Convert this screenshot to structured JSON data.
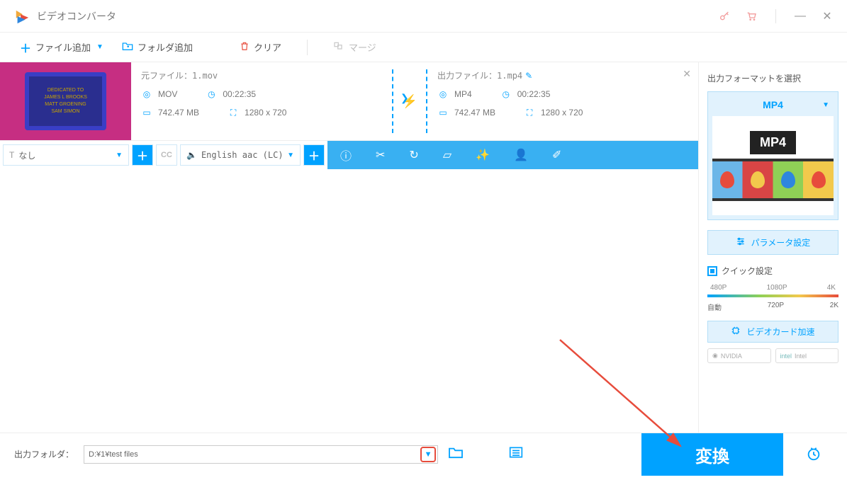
{
  "app_title": "ビデオコンバータ",
  "toolbar": {
    "add_file": "ファイル追加",
    "add_folder": "フォルダ追加",
    "clear": "クリア",
    "merge": "マージ"
  },
  "file": {
    "src_label": "元ファイル：",
    "src_name": "1.mov",
    "src_format": "MOV",
    "src_duration": "00:22:35",
    "src_size": "742.47 MB",
    "src_res": "1280 x 720",
    "out_label": "出力ファイル：",
    "out_name": "1.mp4",
    "out_format": "MP4",
    "out_duration": "00:22:35",
    "out_size": "742.47 MB",
    "out_res": "1280 x 720"
  },
  "sa": {
    "subtitle_value": "なし",
    "audio_value": "English aac (LC)"
  },
  "sidebar": {
    "title": "出力フォーマットを選択",
    "format": "MP4",
    "format_caption": "MP4",
    "param_btn": "パラメータ設定",
    "quick_title": "クイック設定",
    "scale_top": [
      "480P",
      "1080P",
      "4K"
    ],
    "scale_bottom": [
      "自動",
      "720P",
      "2K"
    ],
    "gpu_btn": "ビデオカード加速",
    "gpu_nvidia": "NVIDIA",
    "gpu_intel": "Intel"
  },
  "bottom": {
    "folder_label": "出力フォルダ：",
    "folder_path": "D:¥1¥test files",
    "convert": "変換"
  },
  "thumb_text": "DEDICATED TO\nJAMES L BROOKS\nMATT GROENING\nSAM SIMON"
}
